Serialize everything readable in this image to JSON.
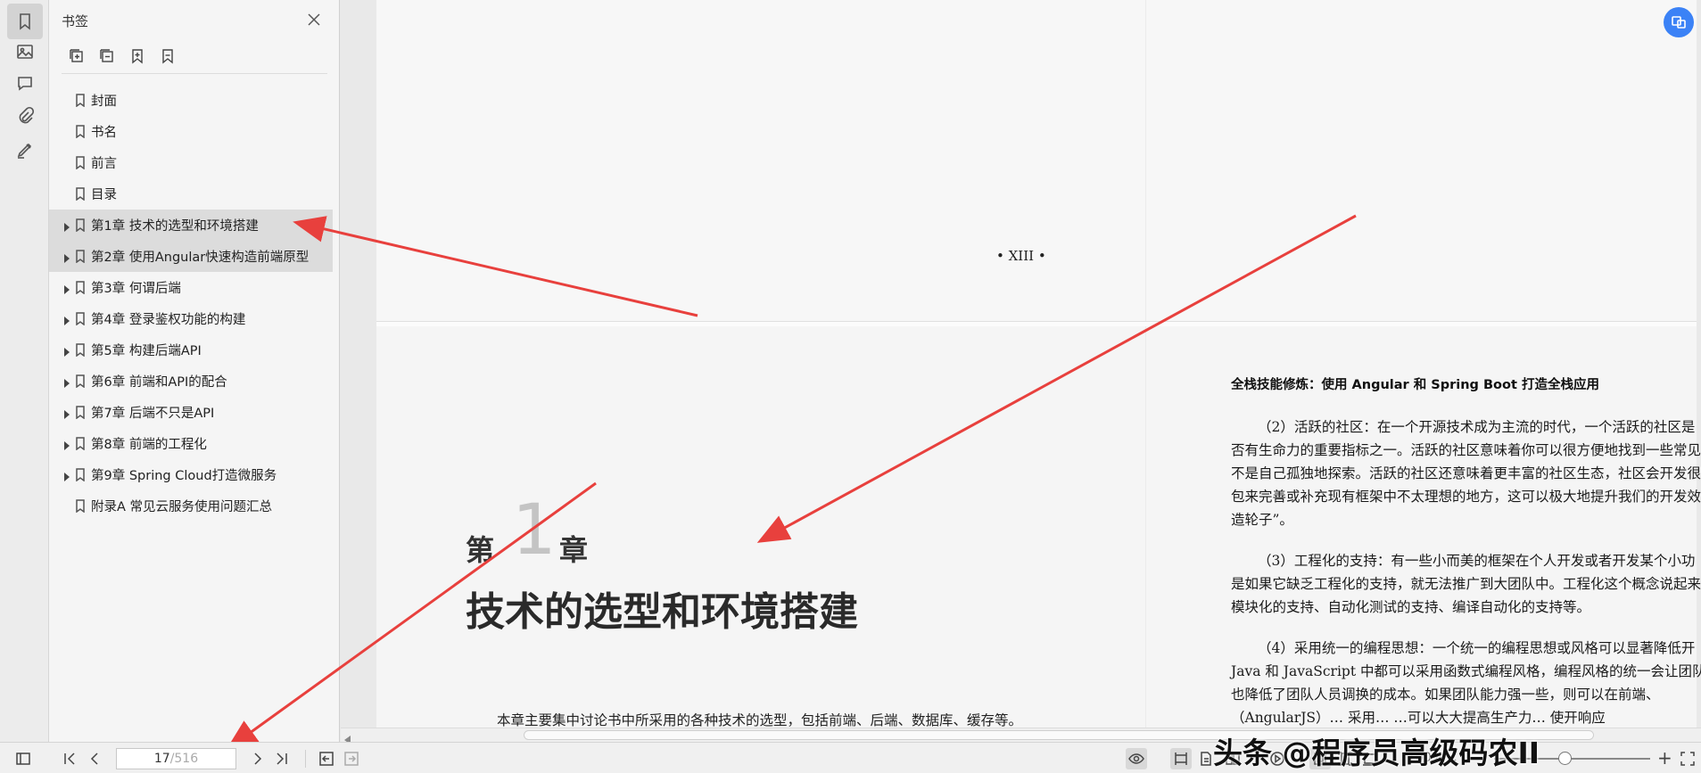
{
  "panel": {
    "title": "书签",
    "items": [
      {
        "label": "封面",
        "expandable": false
      },
      {
        "label": "书名",
        "expandable": false
      },
      {
        "label": "前言",
        "expandable": false
      },
      {
        "label": "目录",
        "expandable": false
      },
      {
        "label": "第1章 技术的选型和环境搭建",
        "expandable": true
      },
      {
        "label": "第2章 使用Angular快速构造前端原型",
        "expandable": true
      },
      {
        "label": "第3章 何谓后端",
        "expandable": true
      },
      {
        "label": "第4章 登录鉴权功能的构建",
        "expandable": true
      },
      {
        "label": "第5章 构建后端API",
        "expandable": true
      },
      {
        "label": "第6章 前端和API的配合",
        "expandable": true
      },
      {
        "label": "第7章 后端不只是API",
        "expandable": true
      },
      {
        "label": "第8章 前端的工程化",
        "expandable": true
      },
      {
        "label": "第9章 Spring Cloud打造微服务",
        "expandable": true
      },
      {
        "label": "附录A 常见云服务使用问题汇总",
        "expandable": false
      }
    ]
  },
  "page1": {
    "page_number": "• XIII •"
  },
  "chapter": {
    "di": "第",
    "num": "1",
    "zhang": "章",
    "title": "技术的选型和环境搭建",
    "intro": "本章主要集中讨论书中所采用的各种技术的选型，包括前端、后端、数据库、缓存等。"
  },
  "right_page": {
    "header": "全栈技能修炼：使用 Angular 和 Spring Boot 打造全栈应用",
    "lines": [
      "（2）活跃的社区：在一个开源技术成为主流的时代，一个活跃的社区是",
      "否有生命力的重要指标之一。活跃的社区意味着你可以很方便地找到一些常见",
      "不是自己孤独地探索。活跃的社区还意味着更丰富的社区生态，社区会开发很",
      "包来完善或补充现有框架中不太理想的地方，这可以极大地提升我们的开发效",
      "造轮子”。",
      "（3）工程化的支持：有一些小而美的框架在个人开发或者开发某个小功",
      "是如果它缺乏工程化的支持，就无法推广到大团队中。工程化这个概念说起来",
      "模块化的支持、自动化测试的支持、编译自动化的支持等。",
      "（4）采用统一的编程思想：一个统一的编程思想或风格可以显著降低开",
      "Java 和 JavaScript 中都可以采用函数式编程风格，编程风格的统一会让团队协",
      "也降低了团队人员调换的成本。如果团队能力强一些，则可以在前端、",
      "（AngularJS）…   采用…  …可以大大提高生产力…  使开响应"
    ]
  },
  "status": {
    "current_page": "17",
    "total_pages": "/516",
    "zoom": "100%"
  },
  "watermark": "头条 @程序员高级码农II",
  "colors": {
    "accent": "#3b82f6",
    "arrow": "#e8403d",
    "highlight": "#dcdcdc"
  }
}
